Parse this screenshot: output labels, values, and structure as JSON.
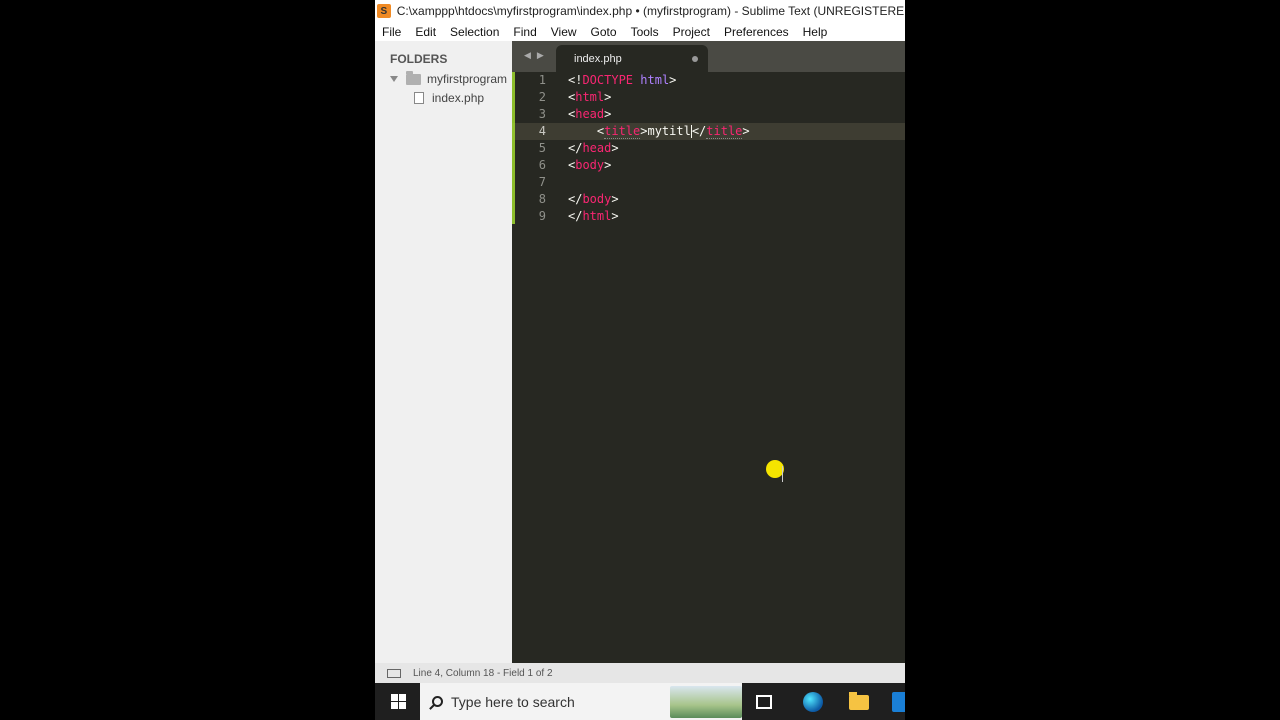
{
  "window": {
    "title": "C:\\xamppp\\htdocs\\myfirstprogram\\index.php • (myfirstprogram) - Sublime Text (UNREGISTERED)"
  },
  "menu": [
    "File",
    "Edit",
    "Selection",
    "Find",
    "View",
    "Goto",
    "Tools",
    "Project",
    "Preferences",
    "Help"
  ],
  "sidebar": {
    "header": "FOLDERS",
    "folder": "myfirstprogram",
    "file": "index.php"
  },
  "tab": {
    "label": "index.php",
    "dirty": true
  },
  "editor": {
    "line_numbers": [
      "1",
      "2",
      "3",
      "4",
      "5",
      "6",
      "7",
      "8",
      "9"
    ],
    "active_line": 4,
    "lines": [
      "<!DOCTYPE html>",
      "<html>",
      "<head>",
      "    <title>mytitl</title>",
      "</head>",
      "<body>",
      "",
      "</body>",
      "</html>"
    ]
  },
  "status": {
    "text": "Line 4, Column 18 - Field 1 of 2"
  },
  "taskbar": {
    "search_placeholder": "Type here to search"
  },
  "colors": {
    "editor_bg": "#272822",
    "tag": "#f92672",
    "keyword": "#ae81ff",
    "text": "#f8f8f2",
    "cursor_highlight": "#f5e400"
  }
}
